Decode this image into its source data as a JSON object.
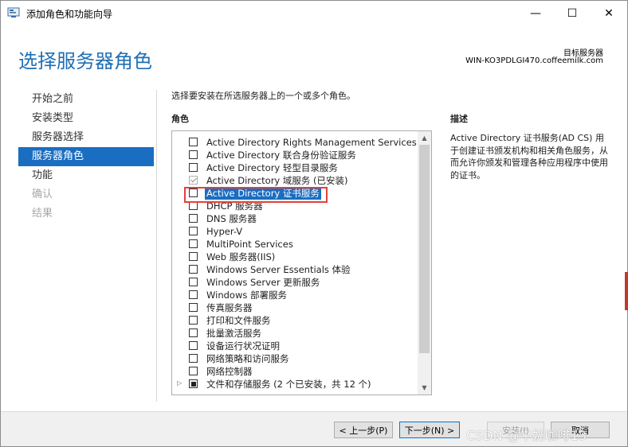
{
  "window": {
    "title": "添加角色和功能向导",
    "icon": "server-manager-icon",
    "minimize_glyph": "—",
    "maximize_glyph": "☐",
    "close_glyph": "✕"
  },
  "header": {
    "page_title": "选择服务器角色",
    "target_server_label": "目标服务器",
    "target_server_name": "WIN-KO3PDLGI470.coffeemilk.com"
  },
  "nav": {
    "items": [
      {
        "label": "开始之前",
        "state": "normal"
      },
      {
        "label": "安装类型",
        "state": "normal"
      },
      {
        "label": "服务器选择",
        "state": "normal"
      },
      {
        "label": "服务器角色",
        "state": "active"
      },
      {
        "label": "功能",
        "state": "normal"
      },
      {
        "label": "确认",
        "state": "disabled"
      },
      {
        "label": "结果",
        "state": "disabled"
      }
    ]
  },
  "main": {
    "instruction": "选择要安装在所选服务器上的一个或多个角色。",
    "roles_heading": "角色",
    "roles": [
      {
        "label": "Active Directory Rights Management Services",
        "checkbox": "unchecked"
      },
      {
        "label": "Active Directory 联合身份验证服务",
        "checkbox": "unchecked"
      },
      {
        "label": "Active Directory 轻型目录服务",
        "checkbox": "unchecked"
      },
      {
        "label": "Active Directory 域服务 (已安装)",
        "checkbox": "checked-disabled"
      },
      {
        "label": "Active Directory 证书服务",
        "checkbox": "unchecked",
        "selected": true
      },
      {
        "label": "DHCP 服务器",
        "checkbox": "unchecked"
      },
      {
        "label": "DNS 服务器",
        "checkbox": "unchecked"
      },
      {
        "label": "Hyper-V",
        "checkbox": "unchecked"
      },
      {
        "label": "MultiPoint Services",
        "checkbox": "unchecked"
      },
      {
        "label": "Web 服务器(IIS)",
        "checkbox": "unchecked"
      },
      {
        "label": "Windows Server Essentials 体验",
        "checkbox": "unchecked"
      },
      {
        "label": "Windows Server 更新服务",
        "checkbox": "unchecked"
      },
      {
        "label": "Windows 部署服务",
        "checkbox": "unchecked"
      },
      {
        "label": "传真服务器",
        "checkbox": "unchecked"
      },
      {
        "label": "打印和文件服务",
        "checkbox": "unchecked"
      },
      {
        "label": "批量激活服务",
        "checkbox": "unchecked"
      },
      {
        "label": "设备运行状况证明",
        "checkbox": "unchecked"
      },
      {
        "label": "网络策略和访问服务",
        "checkbox": "unchecked"
      },
      {
        "label": "网络控制器",
        "checkbox": "unchecked"
      },
      {
        "label": "文件和存储服务 (2 个已安装，共 12 个)",
        "checkbox": "partial",
        "expandable": true
      }
    ],
    "description_heading": "描述",
    "description_text": "Active Directory 证书服务(AD CS) 用于创建证书颁发机构和相关角色服务，从而允许你颁发和管理各种应用程序中使用的证书。"
  },
  "footer": {
    "prev_label": "< 上一步(P)",
    "next_label": "下一步(N) >",
    "install_label": "安装(I)",
    "cancel_label": "取消"
  },
  "watermark": "CSDN @牛奶咖啡13",
  "colors": {
    "accent": "#1a6ec1",
    "title_blue": "#1f6fb5",
    "highlight_red": "#e0423a"
  }
}
